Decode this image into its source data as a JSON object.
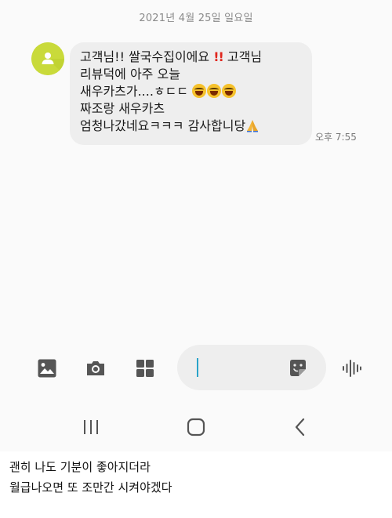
{
  "date_header": "2021년 4월 25일 일요일",
  "message": {
    "line1_text": "고객님!! 쌀국수집이에요 ",
    "line1_bang": "!!",
    "line1_tail": " 고객님",
    "line2": "리뷰덕에 아주 오늘",
    "line3_text": "새우카츠가....ㅎㄷㄷ ",
    "line3_emoji": "laughing-emoji x3",
    "line4": "짜조랑 새우카츠",
    "line5_text": "엄청나갔네요ㅋㅋㅋ 감사합니당",
    "line5_emoji": "folded-hands-emoji",
    "time": "오후 7:55"
  },
  "colors": {
    "avatar": "#c9da3a",
    "bubble": "#eeeeee",
    "caret": "#2aa3c9",
    "icon": "#555555"
  },
  "toolbar": {
    "icons": [
      "image-icon",
      "camera-icon",
      "apps-grid-icon",
      "sticker-icon",
      "voice-icon"
    ],
    "input_value": ""
  },
  "nav": {
    "icons": [
      "recents-icon",
      "home-icon",
      "back-icon"
    ]
  },
  "caption": {
    "line1": "괜히 나도 기분이 좋아지더라",
    "line2": "월급나오면 또 조만간 시켜야겠다"
  }
}
